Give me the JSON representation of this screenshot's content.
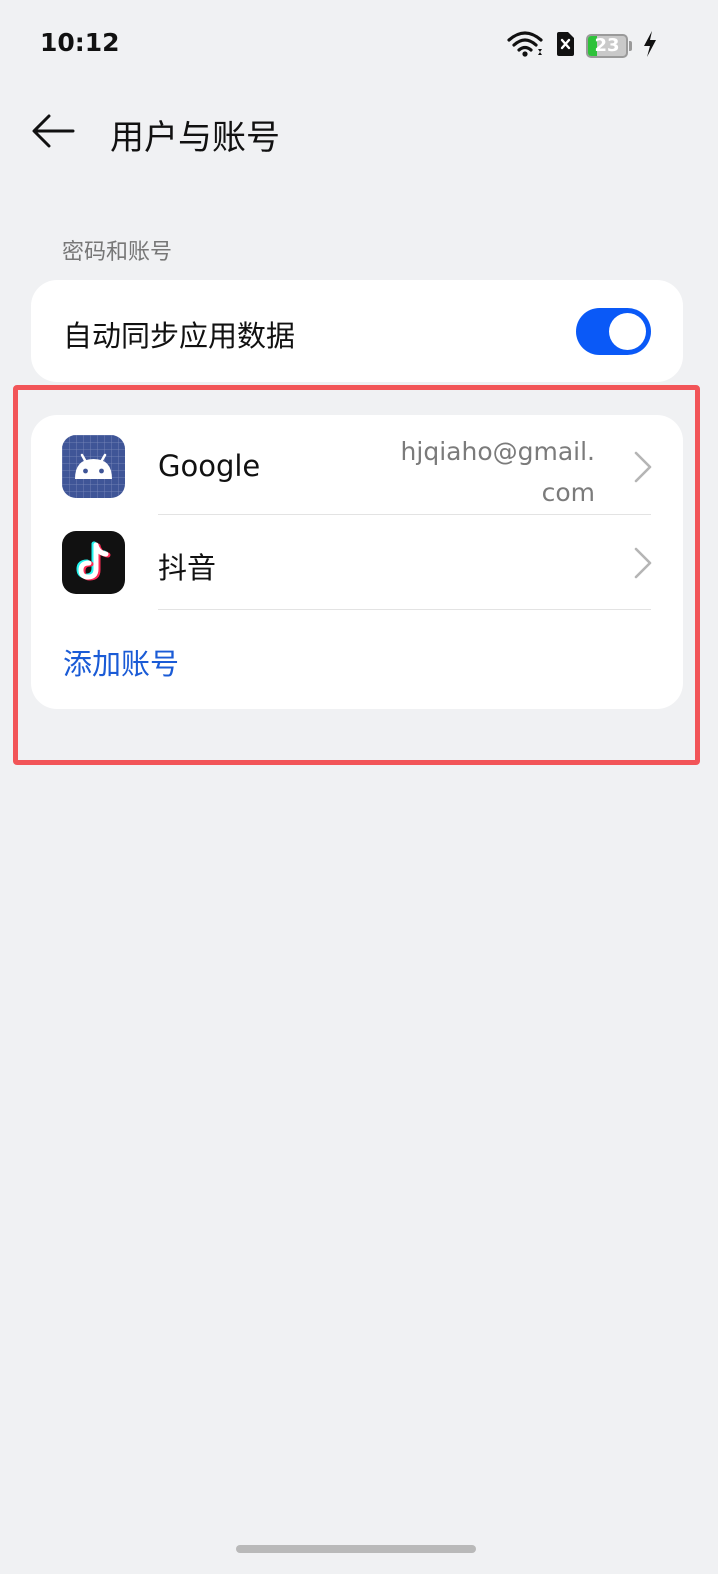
{
  "status_bar": {
    "time": "10:12",
    "battery_level": "23",
    "battery_fraction": 0.23,
    "icons": [
      "wifi-icon",
      "sim-error-icon",
      "battery-icon",
      "charging-icon"
    ],
    "battery_color": "#2ec23a"
  },
  "header": {
    "back_icon": "arrow-left-icon",
    "title": "用户与账号"
  },
  "section": {
    "label": "密码和账号"
  },
  "sync": {
    "label": "自动同步应用数据",
    "enabled": true,
    "toggle_color": "#0a59f7"
  },
  "accounts": {
    "items": [
      {
        "name": "Google",
        "email": "hjqiaho@gmail.com",
        "icon": "android-icon"
      },
      {
        "name": "抖音",
        "icon": "douyin-icon"
      }
    ],
    "add_label": "添加账号",
    "add_color": "#1a5bd6"
  },
  "highlight_color": "#f25558"
}
